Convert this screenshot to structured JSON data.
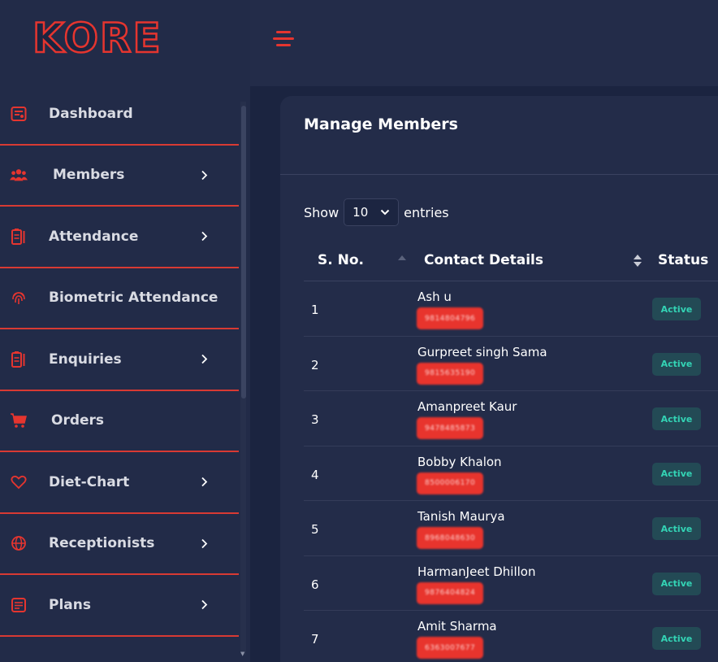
{
  "brand": {
    "logo_text": "KORE"
  },
  "sidebar": {
    "items": [
      {
        "label": "Dashboard",
        "icon": "dashboard-icon",
        "has_chevron": false
      },
      {
        "label": "Members",
        "icon": "users-icon",
        "has_chevron": true
      },
      {
        "label": "Attendance",
        "icon": "clipboard-icon",
        "has_chevron": true
      },
      {
        "label": "Biometric Attendance",
        "icon": "fingerprint-icon",
        "has_chevron": false
      },
      {
        "label": "Enquiries",
        "icon": "clipboard-icon",
        "has_chevron": true
      },
      {
        "label": "Orders",
        "icon": "cart-icon",
        "has_chevron": false
      },
      {
        "label": "Diet-Chart",
        "icon": "heart-icon",
        "has_chevron": true
      },
      {
        "label": "Receptionists",
        "icon": "globe-icon",
        "has_chevron": true
      },
      {
        "label": "Plans",
        "icon": "plans-icon",
        "has_chevron": true
      }
    ]
  },
  "main": {
    "title": "Manage Members",
    "show_label": "Show",
    "entries_value": "10",
    "entries_label": "entries",
    "columns": {
      "sno": "S. No.",
      "contact": "Contact Details",
      "status": "Status"
    },
    "rows": [
      {
        "sno": "1",
        "name": "Ash u",
        "phone": "9814804796",
        "status": "Active"
      },
      {
        "sno": "2",
        "name": "Gurpreet singh Sama",
        "phone": "9815635190",
        "status": "Active"
      },
      {
        "sno": "3",
        "name": "Amanpreet Kaur",
        "phone": "9478485873",
        "status": "Active"
      },
      {
        "sno": "4",
        "name": "Bobby Khalon",
        "phone": "8500006170",
        "status": "Active"
      },
      {
        "sno": "5",
        "name": "Tanish Maurya",
        "phone": "8968048630",
        "status": "Active"
      },
      {
        "sno": "6",
        "name": "HarmanJeet Dhillon",
        "phone": "9876404824",
        "status": "Active"
      },
      {
        "sno": "7",
        "name": "Amit Sharma",
        "phone": "6363007677",
        "status": "Active"
      }
    ]
  },
  "colors": {
    "accent": "#e5352f",
    "background": "#1b2440",
    "panel": "#232c49",
    "active_text": "#33d4b5",
    "active_bg": "#234a55"
  }
}
